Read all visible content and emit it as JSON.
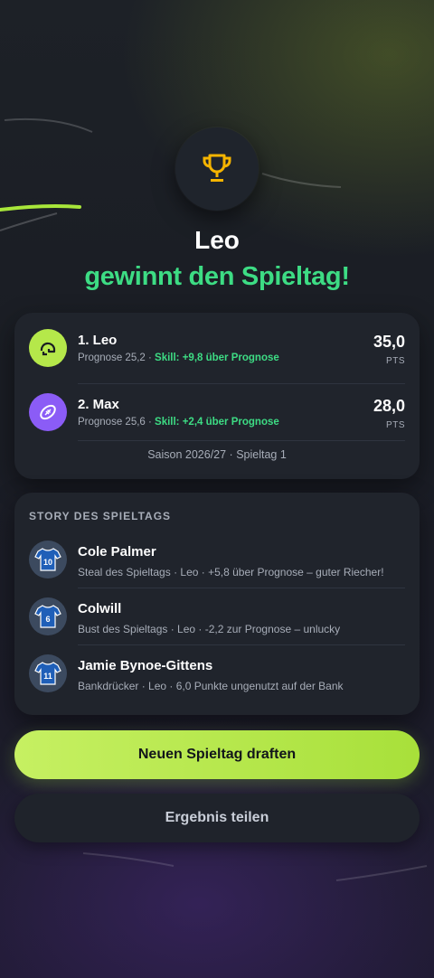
{
  "hero": {
    "winner_name": "Leo",
    "winner_subtitle": "gewinnt den Spieltag!"
  },
  "results": {
    "rows": [
      {
        "rank_name": "1. Leo",
        "prognose": "Prognose 25,2 · ",
        "skill": "Skill: +9,8 über Prognose",
        "points": "35,0",
        "points_label": "PTS"
      },
      {
        "rank_name": "2. Max",
        "prognose": "Prognose 25,6 · ",
        "skill": "Skill: +2,4 über Prognose",
        "points": "28,0",
        "points_label": "PTS"
      }
    ],
    "season": "Saison 2026/27 · Spieltag 1"
  },
  "story": {
    "title": "STORY DES SPIELTAGS",
    "items": [
      {
        "number": "10",
        "name": "Cole Palmer",
        "desc": "Steal des Spieltags · Leo · +5,8 über Prognose – guter Riecher!"
      },
      {
        "number": "6",
        "name": "Colwill",
        "desc": "Bust des Spieltags · Leo · -2,2 zur Prognose – unlucky"
      },
      {
        "number": "11",
        "name": "Jamie Bynoe-Gittens",
        "desc": "Bankdrücker · Leo · 6,0 Punkte ungenutzt auf der Bank"
      }
    ]
  },
  "actions": {
    "primary_label": "Neuen Spieltag draften",
    "secondary_label": "Ergebnis teilen"
  },
  "icons": {
    "trophy": "trophy-icon",
    "avatar_leo": "helmet-icon",
    "avatar_max": "football-icon",
    "jersey": "jersey-icon"
  },
  "colors": {
    "accent_green": "#3ddc84",
    "lime": "#b5e84a",
    "purple": "#8b5cf6",
    "trophy_gold": "#f5b400"
  }
}
